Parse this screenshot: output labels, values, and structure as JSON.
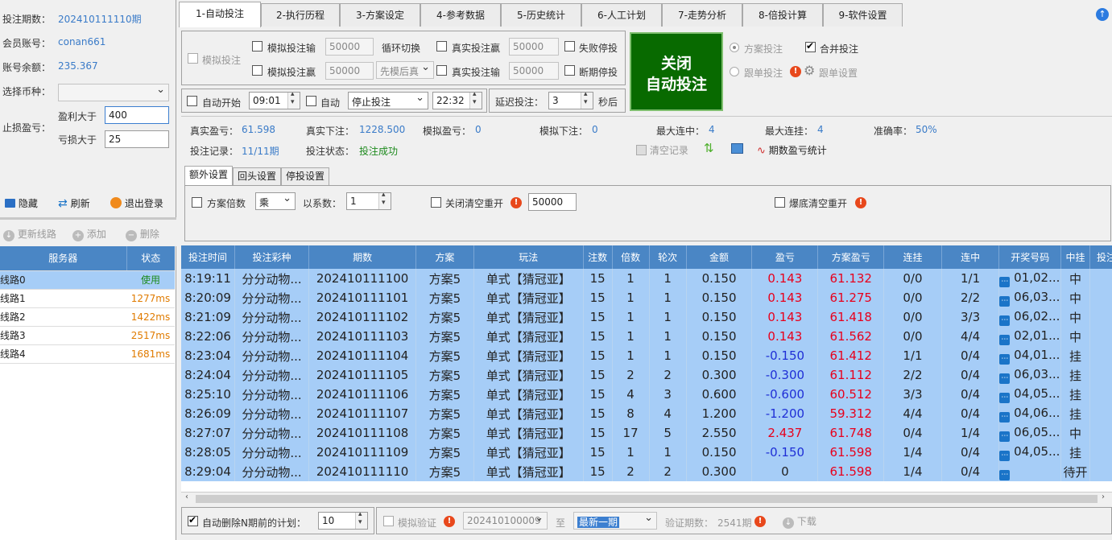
{
  "left": {
    "period_label": "投注期数：",
    "period_value": "202410111110期",
    "account_label": "会员账号：",
    "account_value": "conan661",
    "balance_label": "账号余额：",
    "balance_value": "235.367",
    "currency_label": "选择币种：",
    "stop_label": "止损盈亏：",
    "profit_over_label": "盈利大于",
    "profit_over_value": "400",
    "loss_over_label": "亏损大于",
    "loss_over_value": "25",
    "hide_btn": "隐藏",
    "refresh_btn": "刷新",
    "logout_btn": "退出登录",
    "update_line_btn": "更新线路",
    "add_btn": "添加",
    "delete_btn": "删除",
    "server_headers": [
      "服务器",
      "状态"
    ],
    "servers": [
      {
        "name": "线路0",
        "status": "使用"
      },
      {
        "name": "线路1",
        "status": "1277ms"
      },
      {
        "name": "线路2",
        "status": "1422ms"
      },
      {
        "name": "线路3",
        "status": "2517ms"
      },
      {
        "name": "线路4",
        "status": "1681ms"
      }
    ]
  },
  "tabs": [
    "1-自动投注",
    "2-执行历程",
    "3-方案设定",
    "4-参考数据",
    "5-历史统计",
    "6-人工计划",
    "7-走势分析",
    "8-倍投计算",
    "9-软件设置"
  ],
  "controls": {
    "sim_bet": "模拟投注",
    "sim_loss": "模拟投注输",
    "sim_loss_value": "50000",
    "sim_win": "模拟投注赢",
    "sim_win_value": "50000",
    "cycle_switch": "循环切换",
    "cycle_mode": "先模后真",
    "real_win": "真实投注赢",
    "real_win_value": "50000",
    "real_loss": "真实投注输",
    "real_loss_value": "50000",
    "fail_stop": "失败停投",
    "break_stop": "断期停投",
    "big_btn_line1": "关闭",
    "big_btn_line2": "自动投注",
    "plan_bet": "方案投注",
    "merge_bet": "合并投注",
    "follow_bet": "跟单投注",
    "follow_settings": "跟单设置",
    "auto_start": "自动开始",
    "start_time": "09:01",
    "auto": "自动",
    "auto_action": "停止投注",
    "end_time": "22:32",
    "delay_label": "延迟投注：",
    "delay_value": "3",
    "delay_unit": "秒后"
  },
  "stats": {
    "real_pl_label": "真实盈亏：",
    "real_pl": "61.598",
    "real_bet_label": "真实下注：",
    "real_bet": "1228.500",
    "sim_pl_label": "模拟盈亏：",
    "sim_pl": "0",
    "sim_bet_label": "模拟下注：",
    "sim_bet": "0",
    "max_win_label": "最大连中：",
    "max_win": "4",
    "max_loss_label": "最大连挂：",
    "max_loss": "4",
    "accuracy_label": "准确率：",
    "accuracy": "50%",
    "record_label": "投注记录：",
    "record": "11/11期",
    "status_label": "投注状态：",
    "status": "投注成功",
    "clear_btn": "清空记录",
    "period_stat_btn": "期数盈亏统计"
  },
  "subtabs": [
    "额外设置",
    "回头设置",
    "停投设置"
  ],
  "extra": {
    "plan_multi": "方案倍数",
    "op": "乘",
    "coef_label": "以系数：",
    "coef": "1",
    "close_clear": "关闭清空重开",
    "close_clear_value": "50000",
    "burst_clear": "爆底清空重开"
  },
  "grid": {
    "headers": [
      "投注时间",
      "投注彩种",
      "期数",
      "方案",
      "玩法",
      "注数",
      "倍数",
      "轮次",
      "金额",
      "盈亏",
      "方案盈亏",
      "连挂",
      "连中",
      "开奖号码",
      "中挂",
      "投注"
    ],
    "rows": [
      [
        "8:19:11",
        "分分动物...",
        "202410111100",
        "方案5",
        "单式【猜冠亚】",
        "15",
        "1",
        "1",
        "0.150",
        "0.143",
        "61.132",
        "0/0",
        "1/1",
        "01,02...",
        "中"
      ],
      [
        "8:20:09",
        "分分动物...",
        "202410111101",
        "方案5",
        "单式【猜冠亚】",
        "15",
        "1",
        "1",
        "0.150",
        "0.143",
        "61.275",
        "0/0",
        "2/2",
        "06,03...",
        "中"
      ],
      [
        "8:21:09",
        "分分动物...",
        "202410111102",
        "方案5",
        "单式【猜冠亚】",
        "15",
        "1",
        "1",
        "0.150",
        "0.143",
        "61.418",
        "0/0",
        "3/3",
        "06,02...",
        "中"
      ],
      [
        "8:22:06",
        "分分动物...",
        "202410111103",
        "方案5",
        "单式【猜冠亚】",
        "15",
        "1",
        "1",
        "0.150",
        "0.143",
        "61.562",
        "0/0",
        "4/4",
        "02,01...",
        "中"
      ],
      [
        "8:23:04",
        "分分动物...",
        "202410111104",
        "方案5",
        "单式【猜冠亚】",
        "15",
        "1",
        "1",
        "0.150",
        "-0.150",
        "61.412",
        "1/1",
        "0/4",
        "04,01...",
        "挂"
      ],
      [
        "8:24:04",
        "分分动物...",
        "202410111105",
        "方案5",
        "单式【猜冠亚】",
        "15",
        "2",
        "2",
        "0.300",
        "-0.300",
        "61.112",
        "2/2",
        "0/4",
        "06,03...",
        "挂"
      ],
      [
        "8:25:10",
        "分分动物...",
        "202410111106",
        "方案5",
        "单式【猜冠亚】",
        "15",
        "4",
        "3",
        "0.600",
        "-0.600",
        "60.512",
        "3/3",
        "0/4",
        "04,05...",
        "挂"
      ],
      [
        "8:26:09",
        "分分动物...",
        "202410111107",
        "方案5",
        "单式【猜冠亚】",
        "15",
        "8",
        "4",
        "1.200",
        "-1.200",
        "59.312",
        "4/4",
        "0/4",
        "04,06...",
        "挂"
      ],
      [
        "8:27:07",
        "分分动物...",
        "202410111108",
        "方案5",
        "单式【猜冠亚】",
        "15",
        "17",
        "5",
        "2.550",
        "2.437",
        "61.748",
        "0/4",
        "1/4",
        "06,05...",
        "中"
      ],
      [
        "8:28:05",
        "分分动物...",
        "202410111109",
        "方案5",
        "单式【猜冠亚】",
        "15",
        "1",
        "1",
        "0.150",
        "-0.150",
        "61.598",
        "1/4",
        "0/4",
        "04,05...",
        "挂"
      ],
      [
        "8:29:04",
        "分分动物...",
        "202410111110",
        "方案5",
        "单式【猜冠亚】",
        "15",
        "2",
        "2",
        "0.300",
        "0",
        "61.598",
        "1/4",
        "0/4",
        "",
        "待开"
      ]
    ]
  },
  "bottom": {
    "auto_delete": "自动删除N期前的计划：",
    "auto_delete_value": "10",
    "sim_verify": "模拟验证",
    "from_period": "202410100009",
    "to_label": "至",
    "to_period": "最新一期",
    "verify_count_label": "验证期数：",
    "verify_count": "2541期",
    "download_btn": "下载"
  }
}
